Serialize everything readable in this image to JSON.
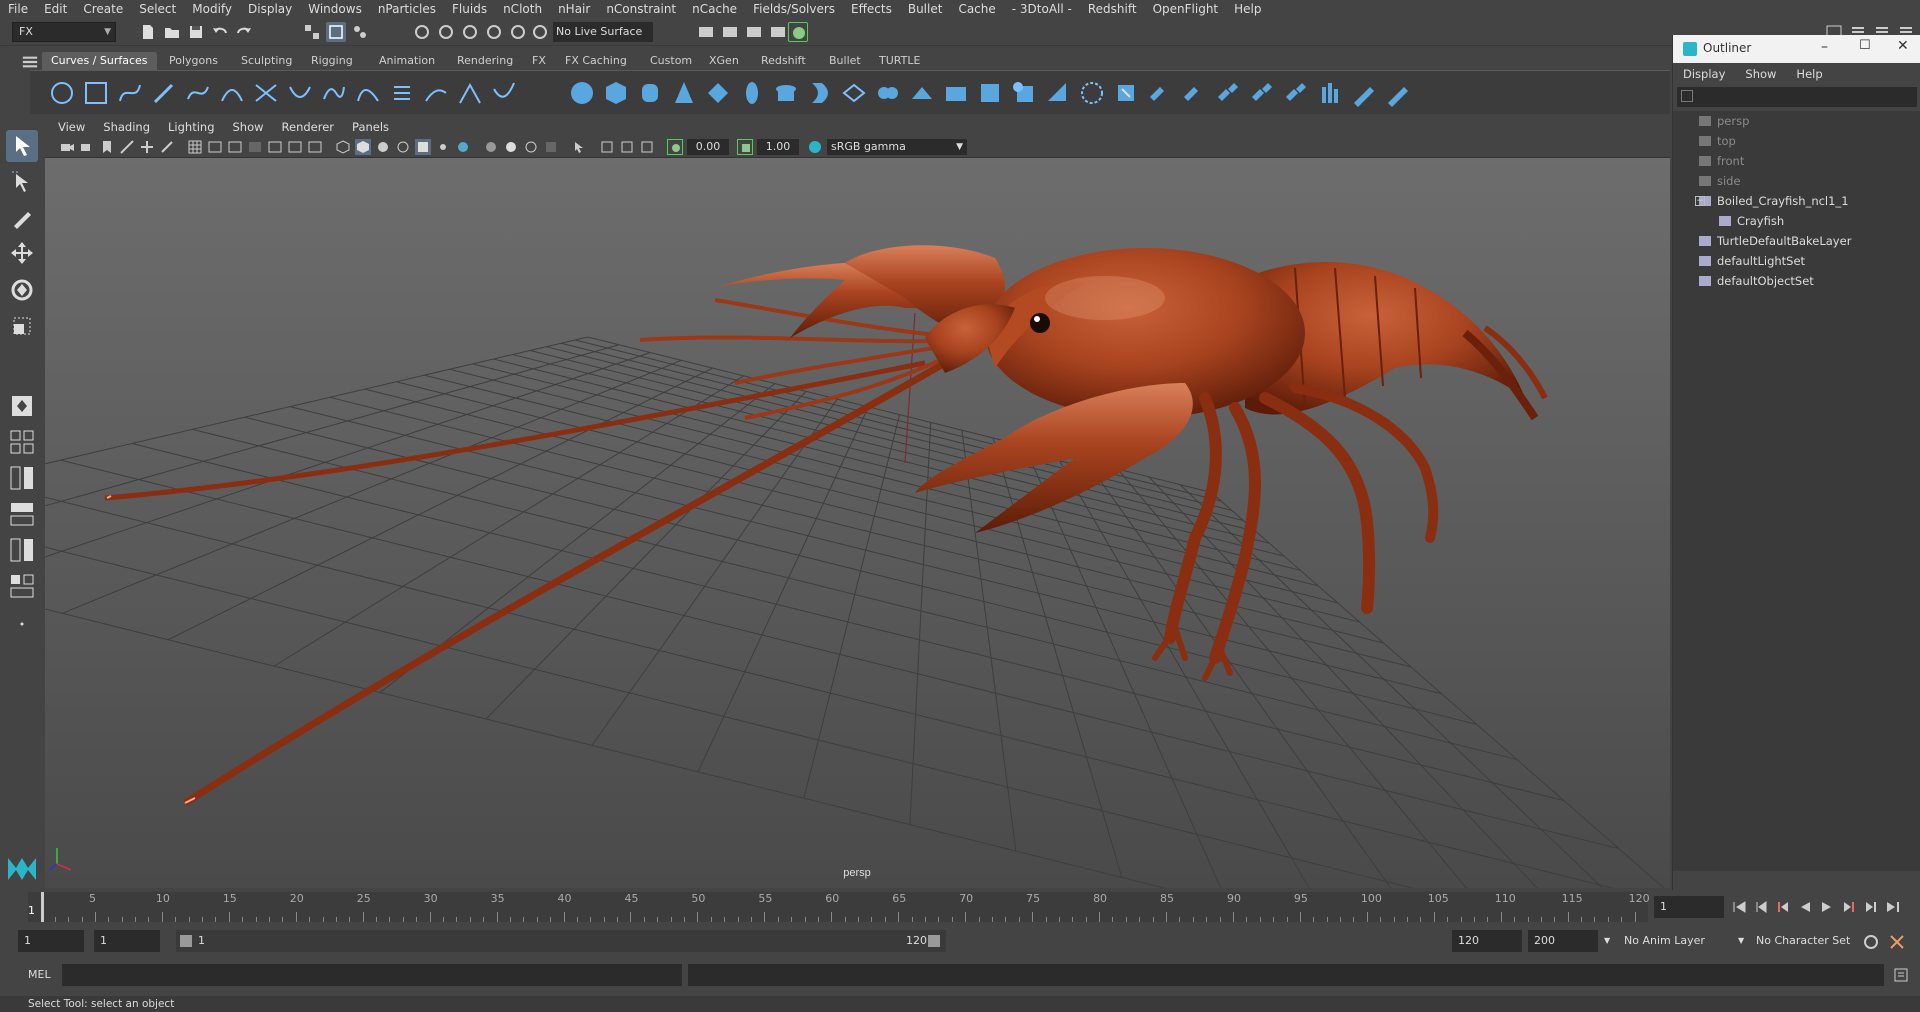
{
  "app": {
    "mode": "FX"
  },
  "menu": [
    "File",
    "Edit",
    "Create",
    "Select",
    "Modify",
    "Display",
    "Windows",
    "nParticles",
    "Fluids",
    "nCloth",
    "nHair",
    "nConstraint",
    "nCache",
    "Fields/Solvers",
    "Effects",
    "Bullet",
    "Cache",
    "- 3DtoAll -",
    "Redshift",
    "OpenFlight",
    "Help"
  ],
  "status": {
    "live_surface": "No Live Surface"
  },
  "shelf_tabs": [
    "Curves / Surfaces",
    "Polygons",
    "Sculpting",
    "Rigging",
    "Animation",
    "Rendering",
    "FX",
    "FX Caching",
    "Custom",
    "XGen",
    "Redshift",
    "Bullet",
    "TURTLE"
  ],
  "shelf_active": "Curves / Surfaces",
  "viewport": {
    "menu": [
      "View",
      "Shading",
      "Lighting",
      "Show",
      "Renderer",
      "Panels"
    ],
    "exposure": "0.00",
    "gamma": "1.00",
    "color_space": "sRGB gamma",
    "camera_label": "persp"
  },
  "outliner": {
    "title": "Outliner",
    "menu": [
      "Display",
      "Show",
      "Help"
    ],
    "items": [
      {
        "label": "persp",
        "dim": true
      },
      {
        "label": "top",
        "dim": true
      },
      {
        "label": "front",
        "dim": true
      },
      {
        "label": "side",
        "dim": true
      },
      {
        "label": "Boiled_Crayfish_ncl1_1",
        "dim": false
      },
      {
        "label": "Crayfish",
        "dim": false
      },
      {
        "label": "TurtleDefaultBakeLayer",
        "dim": false
      },
      {
        "label": "defaultLightSet",
        "dim": false
      },
      {
        "label": "defaultObjectSet",
        "dim": false
      }
    ]
  },
  "timeline": {
    "ticks": [
      "5",
      "10",
      "15",
      "20",
      "25",
      "30",
      "35",
      "40",
      "45",
      "50",
      "55",
      "60",
      "65",
      "70",
      "75",
      "80",
      "85",
      "90",
      "95",
      "100",
      "105",
      "110",
      "115",
      "120"
    ],
    "start_marker": "1",
    "current_frame": "1"
  },
  "range": {
    "start": "1",
    "anim_start": "1",
    "slider_start": "1",
    "slider_end": "120",
    "end": "120",
    "anim_end": "200",
    "anim_layer": "No Anim Layer",
    "character_set": "No Character Set"
  },
  "command": {
    "lang": "MEL"
  },
  "help_line": "Select Tool: select an object"
}
